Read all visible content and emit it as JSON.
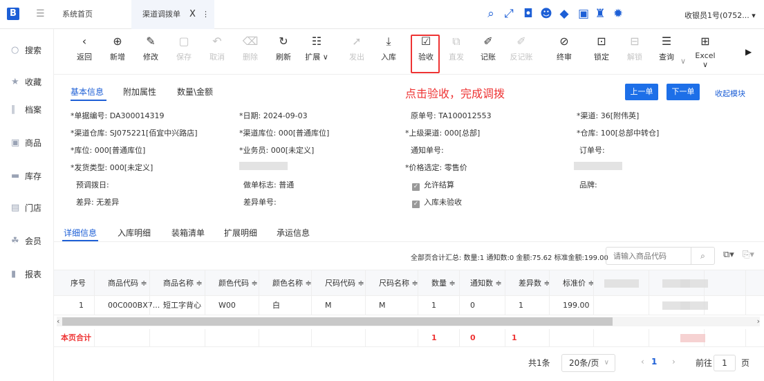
{
  "topbar": {
    "logo": "B",
    "home_tab": "系统首页",
    "active_tab": "渠道调拨单",
    "close": "X",
    "more": "⋮",
    "user": "收银员1号(0752..."
  },
  "top_icons": [
    {
      "icon": "search-icon",
      "glyph": "⌕"
    },
    {
      "icon": "expand-icon",
      "glyph": "⤢"
    },
    {
      "icon": "bag-icon",
      "glyph": "◘"
    },
    {
      "icon": "user-icon",
      "glyph": "☻"
    },
    {
      "icon": "bulb-icon",
      "glyph": "◆"
    },
    {
      "icon": "monitor-icon",
      "glyph": "▣"
    },
    {
      "icon": "shirt-icon",
      "glyph": "♜"
    },
    {
      "icon": "gear-icon",
      "glyph": "✹"
    }
  ],
  "sidebar": [
    {
      "icon": "search-icon",
      "glyph": "○",
      "label": "搜索"
    },
    {
      "icon": "star-icon",
      "glyph": "★",
      "label": "收藏"
    },
    {
      "icon": "archive-icon",
      "glyph": "∥",
      "label": "档案"
    },
    {
      "icon": "product-icon",
      "glyph": "▣",
      "label": "商品"
    },
    {
      "icon": "stock-icon",
      "glyph": "▬",
      "label": "库存"
    },
    {
      "icon": "store-icon",
      "glyph": "▤",
      "label": "门店"
    },
    {
      "icon": "member-icon",
      "glyph": "☘",
      "label": "会员"
    },
    {
      "icon": "report-icon",
      "glyph": "▮",
      "label": "报表"
    }
  ],
  "toolbar": [
    {
      "icon": "back-icon",
      "glyph": "‹",
      "label": "返回",
      "disabled": false
    },
    {
      "icon": "add-icon",
      "glyph": "⊕",
      "label": "新增",
      "disabled": false
    },
    {
      "icon": "edit-icon",
      "glyph": "✎",
      "label": "修改",
      "disabled": false
    },
    {
      "icon": "save-icon",
      "glyph": "▢",
      "label": "保存",
      "disabled": true
    },
    {
      "icon": "undo-icon",
      "glyph": "↶",
      "label": "取消",
      "disabled": true
    },
    {
      "icon": "delete-icon",
      "glyph": "⌫",
      "label": "删除",
      "disabled": true
    },
    {
      "icon": "refresh-icon",
      "glyph": "↻",
      "label": "刷新",
      "disabled": false
    },
    {
      "icon": "extend-icon",
      "glyph": "☷",
      "label": "扩展 ∨",
      "disabled": false
    },
    {
      "icon": "send-icon",
      "glyph": "➚",
      "label": "发出",
      "disabled": true
    },
    {
      "icon": "inbound-icon",
      "glyph": "⤓",
      "label": "入库",
      "disabled": false
    },
    {
      "icon": "check-icon",
      "glyph": "☑",
      "label": "验收",
      "disabled": false
    },
    {
      "icon": "direct-icon",
      "glyph": "⧉",
      "label": "直发",
      "disabled": true
    },
    {
      "icon": "post-icon",
      "glyph": "✐",
      "label": "记账",
      "disabled": false
    },
    {
      "icon": "unpost-icon",
      "glyph": "✐",
      "label": "反记账",
      "disabled": true
    },
    {
      "icon": "audit-icon",
      "glyph": "⊘",
      "label": "终审",
      "disabled": false
    },
    {
      "icon": "lock-icon",
      "glyph": "⊡",
      "label": "锁定",
      "disabled": false
    },
    {
      "icon": "unlock-icon",
      "glyph": "⊟",
      "label": "解锁",
      "disabled": true
    },
    {
      "icon": "query-icon",
      "glyph": "☰",
      "label": "查询",
      "disabled": false
    },
    {
      "icon": "excel-icon",
      "glyph": "⊞",
      "label": "Excel ∨",
      "disabled": false
    }
  ],
  "toolbar_more": "∨",
  "toolbar_next": "▶",
  "section_tabs": [
    "基本信息",
    "附加属性",
    "数量\\金额"
  ],
  "annotation": "点击验收，完成调拨",
  "nav_buttons": {
    "prev": "上一单",
    "next": "下一单",
    "collapse": "收起模块"
  },
  "fields": {
    "doc_no": "*单据编号: DA300014319",
    "date": "*日期: 2024-09-03",
    "orig_no": "原单号: TA100012553",
    "channel": "*渠道: 36[附伟英]",
    "ch_warehouse": "*渠道仓库: SJ075221[佰宜中兴路店]",
    "ch_location": "*渠道库位: 000[普通库位]",
    "parent_ch": "*上级渠道: 000[总部]",
    "warehouse": "*仓库: 100[总部中转仓]",
    "location": "*库位: 000[普通库位]",
    "salesman": "*业务员: 000[未定义]",
    "notice_no": "通知单号:",
    "order_no": "订单号:",
    "ship_type": "*发货类型: 000[未定义]",
    "price_sel": "*价格选定: 零售价",
    "pre_date": "预调拨日:",
    "mark": "做单标志: 普通",
    "brand": "品牌:",
    "diff": "差异: 无差异",
    "diff_no": "差异单号:",
    "allow_settle": "允许结算",
    "unaccepted": "入库未验收"
  },
  "detail_tabs": [
    "详细信息",
    "入库明细",
    "装箱清单",
    "扩展明细",
    "承运信息"
  ],
  "summary": "全部页合计汇总: 数量:1 通知数:0 金额:75.62 标准金额:199.00",
  "search": {
    "placeholder": "请输入商品代码"
  },
  "grid": {
    "headers": [
      "序号",
      "商品代码 ≑",
      "商品名称 ≑",
      "颜色代码 ≑",
      "颜色名称 ≑",
      "尺码代码 ≑",
      "尺码名称 ≑",
      "数量 ≑",
      "通知数 ≑",
      "差异数 ≑",
      "标准价 ≑"
    ],
    "row": [
      "1",
      "00C000BX7...",
      "短工字背心",
      "W00",
      "白",
      "M",
      "M",
      "1",
      "0",
      "1",
      "199.00"
    ],
    "sum_label": "本页合计",
    "sum_qty": "1",
    "sum_notice": "0",
    "sum_diff": "1"
  },
  "pager": {
    "total": "共1条",
    "size": "20条/页",
    "page": "1",
    "goto": "前往",
    "goto_val": "1",
    "page_unit": "页"
  }
}
